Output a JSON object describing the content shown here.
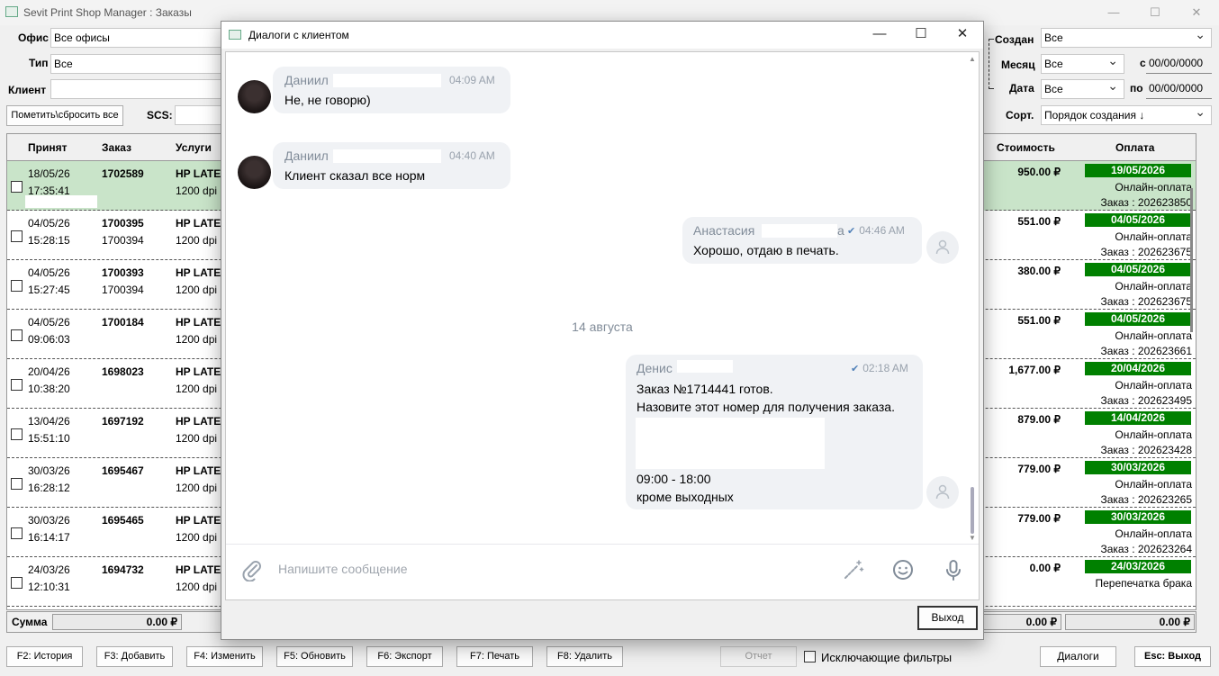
{
  "app": {
    "title": "Sevit Print Shop Manager : Заказы",
    "win_min": "—",
    "win_max": "☐",
    "win_close": "✕"
  },
  "filters": {
    "office_label": "Офис",
    "office_value": "Все офисы",
    "type_label": "Тип",
    "type_value": "Все",
    "client_label": "Клиент",
    "client_value": "",
    "mark_button": "Пометить\\сбросить все",
    "scs_label": "SCS:",
    "created_label": "Создан",
    "created_value": "Все",
    "month_label": "Месяц",
    "month_value": "Все",
    "date_label": "Дата",
    "date_value": "Все",
    "from_label": "с",
    "from_value": "00/00/0000",
    "to_label": "по",
    "to_value": "00/00/0000",
    "sort_label": "Сорт.",
    "sort_value": "Порядок создания ↓"
  },
  "grid": {
    "headers": {
      "accepted": "Принят",
      "order": "Заказ",
      "services": "Услуги",
      "cost": "Стоимость",
      "payment": "Оплата"
    },
    "rows": [
      {
        "date": "18/05/26",
        "time": "17:35:41",
        "order": "1702589",
        "parent": "",
        "service": "HP LATE",
        "dpi": "1200 dpi",
        "cost": "950.00 ₽",
        "pay_date": "19/05/2026",
        "pay_method": "Онлайн-оплата",
        "pay_ref": "Заказ : 202623850"
      },
      {
        "date": "04/05/26",
        "time": "15:28:15",
        "order": "1700395",
        "parent": "1700394",
        "service": "HP LATE",
        "dpi": "1200 dpi",
        "cost": "551.00 ₽",
        "pay_date": "04/05/2026",
        "pay_method": "Онлайн-оплата",
        "pay_ref": "Заказ : 202623675"
      },
      {
        "date": "04/05/26",
        "time": "15:27:45",
        "order": "1700393",
        "parent": "1700394",
        "service": "HP LATE",
        "dpi": "1200 dpi",
        "cost": "380.00 ₽",
        "pay_date": "04/05/2026",
        "pay_method": "Онлайн-оплата",
        "pay_ref": "Заказ : 202623675"
      },
      {
        "date": "04/05/26",
        "time": "09:06:03",
        "order": "1700184",
        "parent": "",
        "service": "HP LATE",
        "dpi": "1200 dpi",
        "cost": "551.00 ₽",
        "pay_date": "04/05/2026",
        "pay_method": "Онлайн-оплата",
        "pay_ref": "Заказ : 202623661"
      },
      {
        "date": "20/04/26",
        "time": "10:38:20",
        "order": "1698023",
        "parent": "",
        "service": "HP LATE",
        "dpi": "1200 dpi",
        "cost": "1,677.00 ₽",
        "pay_date": "20/04/2026",
        "pay_method": "Онлайн-оплата",
        "pay_ref": "Заказ : 202623495"
      },
      {
        "date": "13/04/26",
        "time": "15:51:10",
        "order": "1697192",
        "parent": "",
        "service": "HP LATE",
        "dpi": "1200 dpi",
        "cost": "879.00 ₽",
        "pay_date": "14/04/2026",
        "pay_method": "Онлайн-оплата",
        "pay_ref": "Заказ : 202623428"
      },
      {
        "date": "30/03/26",
        "time": "16:28:12",
        "order": "1695467",
        "parent": "",
        "service": "HP LATE",
        "dpi": "1200 dpi",
        "cost": "779.00 ₽",
        "pay_date": "30/03/2026",
        "pay_method": "Онлайн-оплата",
        "pay_ref": "Заказ : 202623265"
      },
      {
        "date": "30/03/26",
        "time": "16:14:17",
        "order": "1695465",
        "parent": "",
        "service": "HP LATE",
        "dpi": "1200 dpi",
        "cost": "779.00 ₽",
        "pay_date": "30/03/2026",
        "pay_method": "Онлайн-оплата",
        "pay_ref": "Заказ : 202623264"
      },
      {
        "date": "24/03/26",
        "time": "12:10:31",
        "order": "1694732",
        "parent": "",
        "service": "HP LATE",
        "dpi": "1200 dpi",
        "cost": "0.00 ₽",
        "pay_date": "24/03/2026",
        "pay_method": "Перепечатка брака",
        "pay_ref": ""
      }
    ]
  },
  "sum": {
    "label": "Сумма",
    "left": "0.00 ₽",
    "mid": "0.00 ₽",
    "right": "0.00 ₽"
  },
  "bottom": {
    "f2": "F2: История",
    "f3": "F3: Добавить",
    "f4": "F4: Изменить",
    "f5": "F5: Обновить",
    "f6": "F6: Экспорт",
    "f7": "F7: Печать",
    "f8": "F8: Удалить",
    "report": "Отчет",
    "exclusive_filters": "Исключающие фильтры",
    "dialogs": "Диалоги",
    "esc": "Esc: Выход"
  },
  "dialog": {
    "title": "Диалоги с клиентом",
    "messages": [
      {
        "name": "Даниил",
        "time": "04:09 AM",
        "text": "Не, не говорю)"
      },
      {
        "name": "Даниил",
        "time": "04:40 AM",
        "text": "Клиент сказал все норм"
      },
      {
        "name": "Анастасия",
        "name_tail": "а",
        "time": "04:46 AM",
        "text": "Хорошо, отдаю в печать."
      },
      {
        "name": "Денис",
        "time": "02:18 AM",
        "line1": "Заказ №1714441 готов.",
        "line2": "Назовите этот номер для получения заказа.",
        "line3": "09:00 - 18:00",
        "line4": "кроме выходных"
      }
    ],
    "date_separator": "14 августа",
    "input_placeholder": "Напишите сообщение",
    "exit_button": "Выход"
  }
}
